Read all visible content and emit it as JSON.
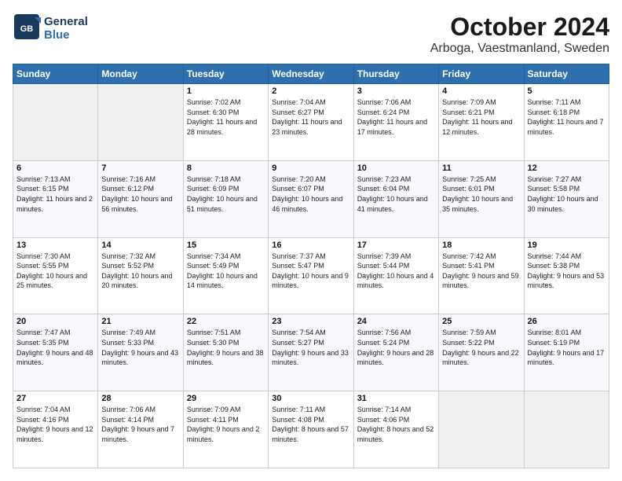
{
  "logo": {
    "line1": "General",
    "line2": "Blue"
  },
  "title": "October 2024",
  "subtitle": "Arboga, Vaestmanland, Sweden",
  "weekdays": [
    "Sunday",
    "Monday",
    "Tuesday",
    "Wednesday",
    "Thursday",
    "Friday",
    "Saturday"
  ],
  "weeks": [
    [
      {
        "day": "",
        "sunrise": "",
        "sunset": "",
        "daylight": ""
      },
      {
        "day": "",
        "sunrise": "",
        "sunset": "",
        "daylight": ""
      },
      {
        "day": "1",
        "sunrise": "Sunrise: 7:02 AM",
        "sunset": "Sunset: 6:30 PM",
        "daylight": "Daylight: 11 hours and 28 minutes."
      },
      {
        "day": "2",
        "sunrise": "Sunrise: 7:04 AM",
        "sunset": "Sunset: 6:27 PM",
        "daylight": "Daylight: 11 hours and 23 minutes."
      },
      {
        "day": "3",
        "sunrise": "Sunrise: 7:06 AM",
        "sunset": "Sunset: 6:24 PM",
        "daylight": "Daylight: 11 hours and 17 minutes."
      },
      {
        "day": "4",
        "sunrise": "Sunrise: 7:09 AM",
        "sunset": "Sunset: 6:21 PM",
        "daylight": "Daylight: 11 hours and 12 minutes."
      },
      {
        "day": "5",
        "sunrise": "Sunrise: 7:11 AM",
        "sunset": "Sunset: 6:18 PM",
        "daylight": "Daylight: 11 hours and 7 minutes."
      }
    ],
    [
      {
        "day": "6",
        "sunrise": "Sunrise: 7:13 AM",
        "sunset": "Sunset: 6:15 PM",
        "daylight": "Daylight: 11 hours and 2 minutes."
      },
      {
        "day": "7",
        "sunrise": "Sunrise: 7:16 AM",
        "sunset": "Sunset: 6:12 PM",
        "daylight": "Daylight: 10 hours and 56 minutes."
      },
      {
        "day": "8",
        "sunrise": "Sunrise: 7:18 AM",
        "sunset": "Sunset: 6:09 PM",
        "daylight": "Daylight: 10 hours and 51 minutes."
      },
      {
        "day": "9",
        "sunrise": "Sunrise: 7:20 AM",
        "sunset": "Sunset: 6:07 PM",
        "daylight": "Daylight: 10 hours and 46 minutes."
      },
      {
        "day": "10",
        "sunrise": "Sunrise: 7:23 AM",
        "sunset": "Sunset: 6:04 PM",
        "daylight": "Daylight: 10 hours and 41 minutes."
      },
      {
        "day": "11",
        "sunrise": "Sunrise: 7:25 AM",
        "sunset": "Sunset: 6:01 PM",
        "daylight": "Daylight: 10 hours and 35 minutes."
      },
      {
        "day": "12",
        "sunrise": "Sunrise: 7:27 AM",
        "sunset": "Sunset: 5:58 PM",
        "daylight": "Daylight: 10 hours and 30 minutes."
      }
    ],
    [
      {
        "day": "13",
        "sunrise": "Sunrise: 7:30 AM",
        "sunset": "Sunset: 5:55 PM",
        "daylight": "Daylight: 10 hours and 25 minutes."
      },
      {
        "day": "14",
        "sunrise": "Sunrise: 7:32 AM",
        "sunset": "Sunset: 5:52 PM",
        "daylight": "Daylight: 10 hours and 20 minutes."
      },
      {
        "day": "15",
        "sunrise": "Sunrise: 7:34 AM",
        "sunset": "Sunset: 5:49 PM",
        "daylight": "Daylight: 10 hours and 14 minutes."
      },
      {
        "day": "16",
        "sunrise": "Sunrise: 7:37 AM",
        "sunset": "Sunset: 5:47 PM",
        "daylight": "Daylight: 10 hours and 9 minutes."
      },
      {
        "day": "17",
        "sunrise": "Sunrise: 7:39 AM",
        "sunset": "Sunset: 5:44 PM",
        "daylight": "Daylight: 10 hours and 4 minutes."
      },
      {
        "day": "18",
        "sunrise": "Sunrise: 7:42 AM",
        "sunset": "Sunset: 5:41 PM",
        "daylight": "Daylight: 9 hours and 59 minutes."
      },
      {
        "day": "19",
        "sunrise": "Sunrise: 7:44 AM",
        "sunset": "Sunset: 5:38 PM",
        "daylight": "Daylight: 9 hours and 53 minutes."
      }
    ],
    [
      {
        "day": "20",
        "sunrise": "Sunrise: 7:47 AM",
        "sunset": "Sunset: 5:35 PM",
        "daylight": "Daylight: 9 hours and 48 minutes."
      },
      {
        "day": "21",
        "sunrise": "Sunrise: 7:49 AM",
        "sunset": "Sunset: 5:33 PM",
        "daylight": "Daylight: 9 hours and 43 minutes."
      },
      {
        "day": "22",
        "sunrise": "Sunrise: 7:51 AM",
        "sunset": "Sunset: 5:30 PM",
        "daylight": "Daylight: 9 hours and 38 minutes."
      },
      {
        "day": "23",
        "sunrise": "Sunrise: 7:54 AM",
        "sunset": "Sunset: 5:27 PM",
        "daylight": "Daylight: 9 hours and 33 minutes."
      },
      {
        "day": "24",
        "sunrise": "Sunrise: 7:56 AM",
        "sunset": "Sunset: 5:24 PM",
        "daylight": "Daylight: 9 hours and 28 minutes."
      },
      {
        "day": "25",
        "sunrise": "Sunrise: 7:59 AM",
        "sunset": "Sunset: 5:22 PM",
        "daylight": "Daylight: 9 hours and 22 minutes."
      },
      {
        "day": "26",
        "sunrise": "Sunrise: 8:01 AM",
        "sunset": "Sunset: 5:19 PM",
        "daylight": "Daylight: 9 hours and 17 minutes."
      }
    ],
    [
      {
        "day": "27",
        "sunrise": "Sunrise: 7:04 AM",
        "sunset": "Sunset: 4:16 PM",
        "daylight": "Daylight: 9 hours and 12 minutes."
      },
      {
        "day": "28",
        "sunrise": "Sunrise: 7:06 AM",
        "sunset": "Sunset: 4:14 PM",
        "daylight": "Daylight: 9 hours and 7 minutes."
      },
      {
        "day": "29",
        "sunrise": "Sunrise: 7:09 AM",
        "sunset": "Sunset: 4:11 PM",
        "daylight": "Daylight: 9 hours and 2 minutes."
      },
      {
        "day": "30",
        "sunrise": "Sunrise: 7:11 AM",
        "sunset": "Sunset: 4:08 PM",
        "daylight": "Daylight: 8 hours and 57 minutes."
      },
      {
        "day": "31",
        "sunrise": "Sunrise: 7:14 AM",
        "sunset": "Sunset: 4:06 PM",
        "daylight": "Daylight: 8 hours and 52 minutes."
      },
      {
        "day": "",
        "sunrise": "",
        "sunset": "",
        "daylight": ""
      },
      {
        "day": "",
        "sunrise": "",
        "sunset": "",
        "daylight": ""
      }
    ]
  ]
}
